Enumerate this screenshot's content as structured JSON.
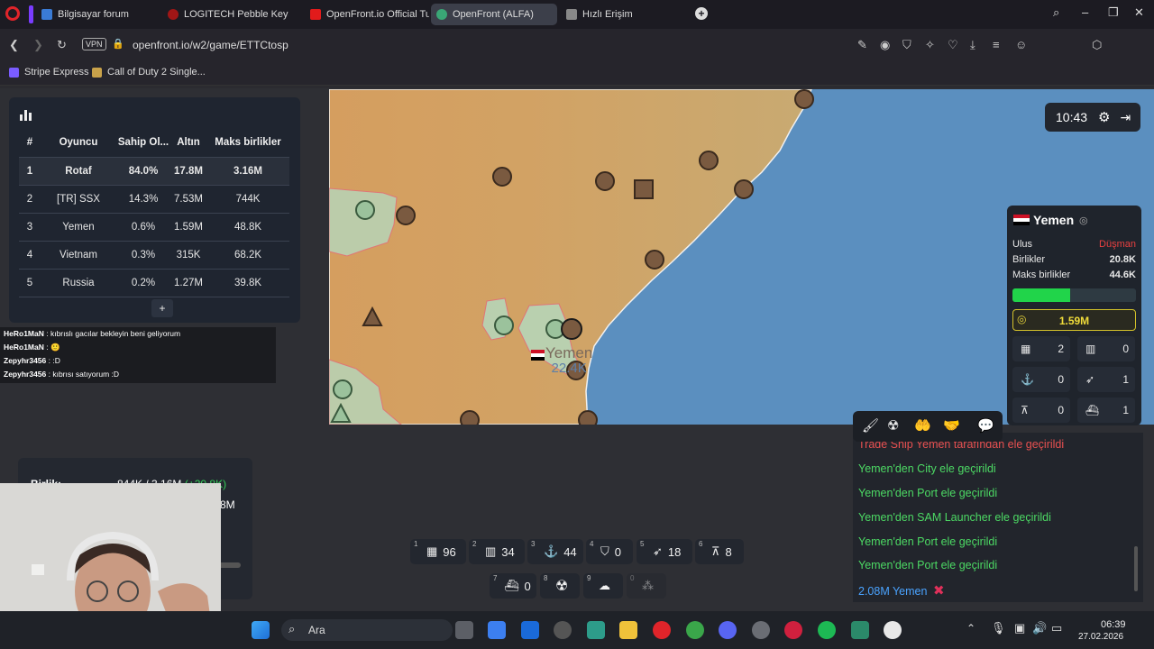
{
  "browser": {
    "tabs": [
      {
        "label": "Bilgisayar forum",
        "color": "#3a7bd5"
      },
      {
        "label": "LOGITECH Pebble Keys 2 K",
        "color": "#a01616"
      },
      {
        "label": "OpenFront.io Official Tuto",
        "color": "#e21b1b"
      },
      {
        "label": "OpenFront (ALFA)",
        "color": "#3aa676"
      },
      {
        "label": "Hızlı Erişim",
        "color": "#888888"
      }
    ],
    "url": "openfront.io/w2/game/ETTCtosp",
    "vpn_label": "VPN",
    "ai_label": "AI",
    "bookmarks": [
      "Stripe Express",
      "Call of Duty 2 Single..."
    ]
  },
  "leaderboard": {
    "headers": [
      "#",
      "Oyuncu",
      "Sahip Ol...",
      "Altın",
      "Maks birlikler"
    ],
    "rows": [
      [
        "1",
        "Rotaf",
        "84.0%",
        "17.8M",
        "3.16M"
      ],
      [
        "2",
        "[TR] SSX",
        "14.3%",
        "7.53M",
        "744K"
      ],
      [
        "3",
        "Yemen",
        "0.6%",
        "1.59M",
        "48.8K"
      ],
      [
        "4",
        "Vietnam",
        "0.3%",
        "315K",
        "68.2K"
      ],
      [
        "5",
        "Russia",
        "0.2%",
        "1.27M",
        "39.8K"
      ]
    ],
    "expand_label": "+"
  },
  "chat": [
    {
      "user": "HeRo1MaN",
      "msg": ": kıbrıslı gacılar bekleyin beni geliyorum"
    },
    {
      "user": "HeRo1MaN",
      "msg": ": 🙂"
    },
    {
      "user": "Zepyhr3456",
      "msg": ": :D"
    },
    {
      "user": "Zepyhr3456",
      "msg": ": kıbrısı satıyorum :D"
    }
  ],
  "map": {
    "nation_label": "Yemen",
    "nation_troops": "22.4K"
  },
  "timer": "10:43",
  "player_panel": {
    "name": "Yemen",
    "rows": [
      {
        "label": "Ulus",
        "value": "Düşman",
        "color": "#e84040"
      },
      {
        "label": "Birlikler",
        "value": "20.8K",
        "color": "#ffffff"
      },
      {
        "label": "Maks birlikler",
        "value": "44.6K",
        "color": "#ffffff"
      }
    ],
    "troop_fill_pct": 47,
    "gold": "1.59M",
    "units": [
      "2",
      "0",
      "0",
      "1",
      "0",
      "1"
    ]
  },
  "events": [
    {
      "text": "Trade Ship Yemen tarafından ele geçirildi",
      "color": "#e85050"
    },
    {
      "text": "Yemen'den City ele geçirildi",
      "color": "#4cd964"
    },
    {
      "text": "Yemen'den Port ele geçirildi",
      "color": "#4cd964"
    },
    {
      "text": "Yemen'den SAM Launcher ele geçirildi",
      "color": "#4cd964"
    },
    {
      "text": "Yemen'den Port ele geçirildi",
      "color": "#4cd964"
    },
    {
      "text": "Yemen'den Port ele geçirildi",
      "color": "#4cd964"
    },
    {
      "text": "2.08M Yemen",
      "color": "#4aa3ff"
    }
  ],
  "unit_bar": [
    {
      "key": "1",
      "count": "96",
      "icon": "city-icon"
    },
    {
      "key": "2",
      "count": "34",
      "icon": "factory-icon"
    },
    {
      "key": "3",
      "count": "44",
      "icon": "port-icon"
    },
    {
      "key": "4",
      "count": "0",
      "icon": "defense-post-icon"
    },
    {
      "key": "5",
      "count": "18",
      "icon": "missile-silo-icon"
    },
    {
      "key": "6",
      "count": "8",
      "icon": "sam-launcher-icon"
    },
    {
      "key": "7",
      "count": "0",
      "icon": "warship-icon"
    },
    {
      "key": "8",
      "count": "",
      "icon": "atom-bomb-icon"
    },
    {
      "key": "9",
      "count": "",
      "icon": "hydrogen-bomb-icon"
    },
    {
      "key": "0",
      "count": "",
      "icon": "mirv-icon"
    }
  ],
  "troops_panel": {
    "label": "Birlik:",
    "value": "844K / 3.16M",
    "delta": "(+20.8K)",
    "gold_partial": "8M"
  },
  "taskbar": {
    "search_placeholder": "Ara",
    "time": "06:39",
    "date": "27.02.2026"
  }
}
